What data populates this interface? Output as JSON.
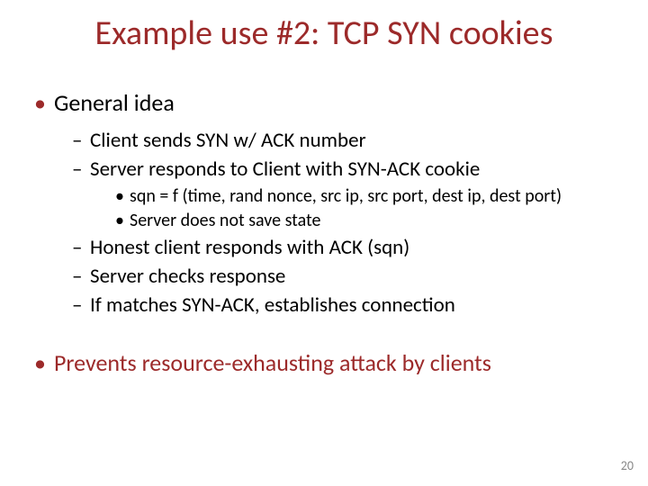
{
  "title": "Example use #2:  TCP SYN cookies",
  "bullets": {
    "l1_1": "General idea",
    "l2_1": "Client sends SYN w/ ACK number",
    "l2_2": "Server responds to Client with SYN-ACK cookie",
    "l3_1": "sqn = f (time, rand nonce, src ip, src port, dest ip, dest port)",
    "l3_2": "Server does not save state",
    "l2_3": "Honest client responds with ACK (sqn)",
    "l2_4": "Server checks response",
    "l2_5": "If matches SYN-ACK, establishes connection",
    "l1_2": "Prevents resource-exhausting attack by clients"
  },
  "page_number": "20"
}
